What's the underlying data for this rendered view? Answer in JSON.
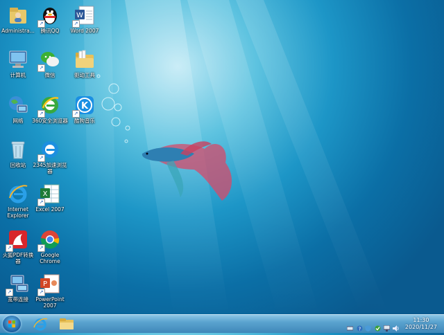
{
  "desktop": {
    "icons": [
      {
        "label": "Administra..."
      },
      {
        "label": "腾讯QQ"
      },
      {
        "label": "Word 2007"
      },
      {
        "label": "计算机"
      },
      {
        "label": "微信"
      },
      {
        "label": "驱动工具"
      },
      {
        "label": "网络"
      },
      {
        "label": "360安全浏览器"
      },
      {
        "label": "酷狗音乐"
      },
      {
        "label": "回收站"
      },
      {
        "label": "2345加速浏览器"
      },
      {
        "label": "Internet Explorer"
      },
      {
        "label": "Excel 2007"
      },
      {
        "label": "火狐PDF转换器"
      },
      {
        "label": "Google Chrome"
      },
      {
        "label": "宽带连接"
      },
      {
        "label": "PowerPoint 2007"
      }
    ]
  },
  "taskbar": {
    "pinned": [
      "internet-explorer-icon",
      "file-explorer-icon"
    ],
    "clock": {
      "time": "11:30",
      "date": "2020/11/27"
    }
  },
  "colors": {
    "taskbar": "#4f97c6",
    "wallpaper": "#1d96c7"
  }
}
